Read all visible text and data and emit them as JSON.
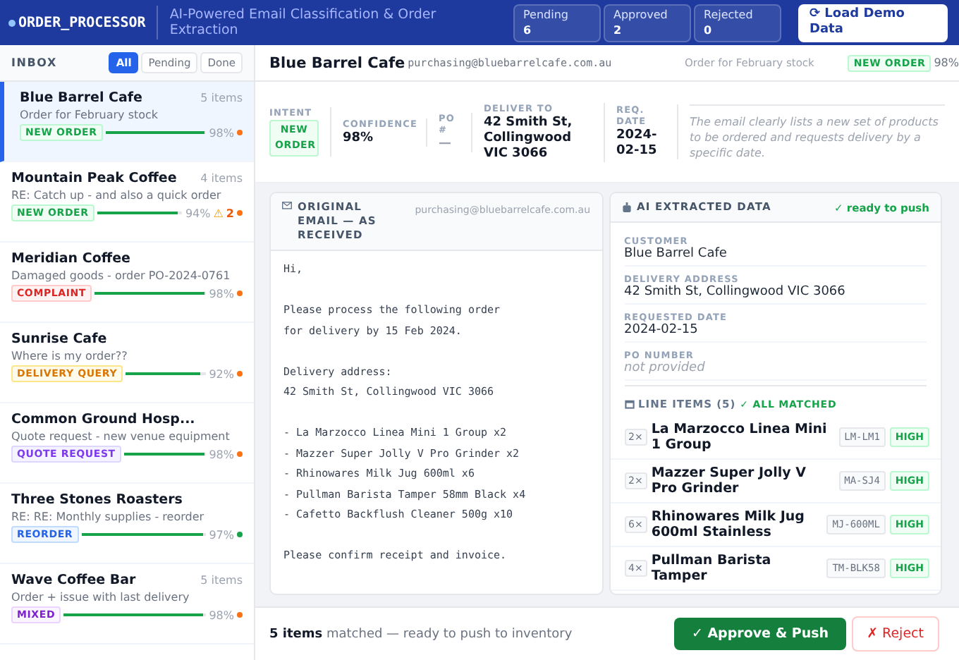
{
  "header": {
    "logo": "ORDER_PROCESSOR",
    "subtitle": "AI-Powered Email Classification & Order Extraction",
    "stats": [
      {
        "label": "Pending",
        "value": "6"
      },
      {
        "label": "Approved",
        "value": "2"
      },
      {
        "label": "Rejected",
        "value": "0"
      }
    ],
    "load_button": "⟳ Load Demo Data"
  },
  "inbox": {
    "title": "INBOX",
    "filters": [
      {
        "label": "All",
        "selected": true
      },
      {
        "label": "Pending",
        "selected": false
      },
      {
        "label": "Done",
        "selected": false
      }
    ],
    "items": [
      {
        "name": "Blue Barrel Cafe",
        "count": "5 items",
        "subject": "Order for February stock",
        "intent": "NEW ORDER",
        "kind": "new_order",
        "level": 0.98,
        "confidence": "98%",
        "color": "#f97316",
        "selected": true
      },
      {
        "name": "Mountain Peak Coffee",
        "count": "4 items",
        "subject": "RE: Catch up - and also a quick order",
        "intent": "NEW ORDER",
        "kind": "new_order",
        "level": 0.94,
        "confidence": "94%",
        "warning": "⚠",
        "warning_count": "2",
        "color": "#f97316",
        "selected": false
      },
      {
        "name": "Meridian Coffee",
        "subject": "Damaged goods - order PO-2024-0761",
        "intent": "COMPLAINT",
        "kind": "complaint",
        "level": 0.98,
        "confidence": "98%",
        "color": "#f97316",
        "selected": false
      },
      {
        "name": "Sunrise Cafe",
        "subject": "Where is my order??",
        "intent": "DELIVERY QUERY",
        "kind": "delivery_query",
        "level": 0.92,
        "confidence": "92%",
        "color": "#f97316",
        "selected": false
      },
      {
        "name": "Common Ground Hosp...",
        "subject": "Quote request - new venue equipment",
        "intent": "QUOTE REQUEST",
        "kind": "quote_request",
        "level": 0.98,
        "confidence": "98%",
        "color": "#f97316",
        "selected": false
      },
      {
        "name": "Three Stones Roasters",
        "subject": "RE: RE: Monthly supplies - reorder",
        "intent": "REORDER",
        "kind": "reorder",
        "level": 0.97,
        "confidence": "97%",
        "color": "#16a34a",
        "selected": false
      },
      {
        "name": "Wave Coffee Bar",
        "count": "5 items",
        "subject": "Order + issue with last delivery",
        "intent": "MIXED",
        "kind": "mixed",
        "level": 0.98,
        "confidence": "98%",
        "color": "#f97316",
        "selected": false
      }
    ]
  },
  "detail": {
    "customer": "Blue Barrel Cafe",
    "email": "purchasing@bluebarrelcafe.com.au",
    "subject": "Order for February stock",
    "intent": "NEW ORDER",
    "kind": "new_order",
    "confidence": "98%",
    "summary": {
      "intent": {
        "label": "INTENT",
        "value": "NEW ORDER",
        "kind": "new_order"
      },
      "fields": [
        {
          "label": "CONFIDENCE",
          "value": "98%",
          "kind": "text"
        },
        {
          "label": "PO #",
          "value": "—",
          "kind": "muted"
        },
        {
          "label": "DELIVER TO",
          "value": "42 Smith St, Collingwood VIC 3066",
          "kind": "text"
        },
        {
          "label": "REQ. DATE",
          "value": "2024-02-15",
          "kind": "text"
        }
      ],
      "reasoning": "The email clearly lists a new set of products to be ordered and requests delivery by a specific date."
    },
    "email_panel": {
      "title": "ORIGINAL EMAIL — AS RECEIVED",
      "from": "purchasing@bluebarrelcafe.com.au",
      "paragraphs": [
        [
          "Hi,"
        ],
        [
          "Please process the following order",
          "for delivery by 15 Feb 2024."
        ],
        [
          "Delivery address:",
          "42 Smith St, Collingwood VIC 3066"
        ],
        [
          "- La Marzocco Linea Mini 1 Group x2",
          "- Mazzer Super Jolly V Pro Grinder x2",
          "- Rhinowares Milk Jug 600ml x6",
          "- Pullman Barista Tamper 58mm Black x4",
          "- Cafetto Backflush Cleaner 500g x10"
        ],
        [
          "Please confirm receipt and invoice."
        ]
      ]
    },
    "extracted_panel": {
      "title": "AI EXTRACTED DATA",
      "status": "✓ ready to push",
      "fields": [
        {
          "label": "CUSTOMER",
          "value": "Blue Barrel Cafe",
          "kind": "text"
        },
        {
          "label": "DELIVERY ADDRESS",
          "value": "42 Smith St, Collingwood VIC 3066",
          "kind": "text"
        },
        {
          "label": "REQUESTED DATE",
          "value": "2024-02-15",
          "kind": "text"
        },
        {
          "label": "PO NUMBER",
          "value": "not provided",
          "kind": "missing"
        }
      ],
      "line_items_title": "LINE ITEMS (5)",
      "match_status": "✓ ALL MATCHED",
      "line_items": [
        {
          "qty": "2×",
          "name": "La Marzocco Linea Mini 1 Group",
          "sku": "LM-LM1",
          "match": "HIGH"
        },
        {
          "qty": "2×",
          "name": "Mazzer Super Jolly V Pro Grinder",
          "sku": "MA-SJ4",
          "match": "HIGH"
        },
        {
          "qty": "6×",
          "name": "Rhinowares Milk Jug 600ml Stainless",
          "sku": "MJ-600ML",
          "match": "HIGH"
        },
        {
          "qty": "4×",
          "name": "Pullman Barista Tamper",
          "sku": "TM-BLK58",
          "match": "HIGH"
        }
      ]
    },
    "footer": {
      "summary": "**5 items** matched — ready to push to inventory",
      "approve": "✓ Approve & Push",
      "reject": "✗ Reject"
    }
  }
}
